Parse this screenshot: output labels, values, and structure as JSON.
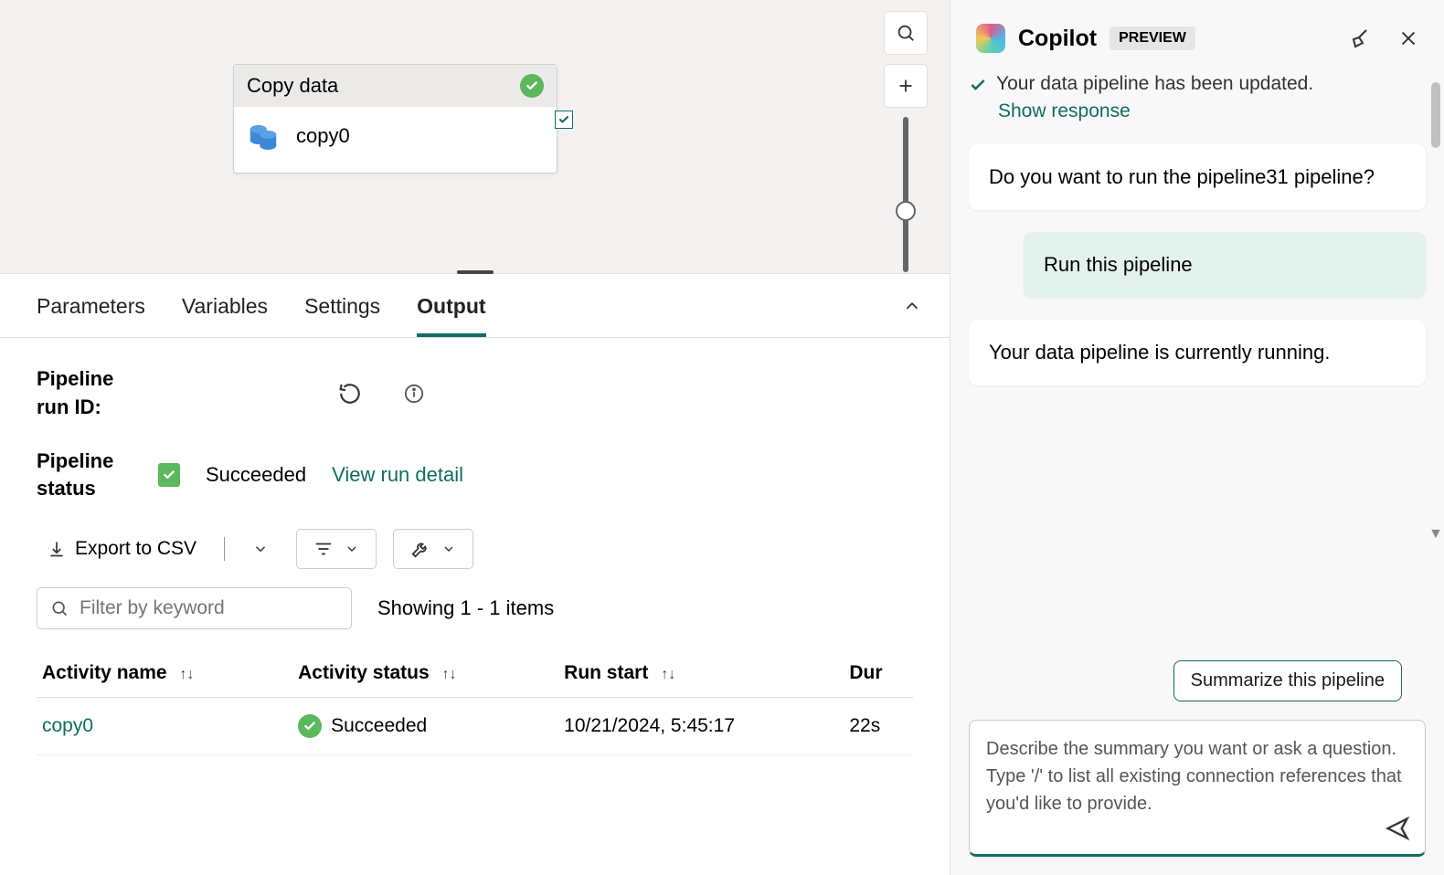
{
  "canvas": {
    "activity": {
      "title": "Copy data",
      "name": "copy0"
    }
  },
  "tabs": {
    "parameters": "Parameters",
    "variables": "Variables",
    "settings": "Settings",
    "output": "Output"
  },
  "output": {
    "run_id_label": "Pipeline run ID:",
    "status_label": "Pipeline status",
    "status_value": "Succeeded",
    "view_detail": "View run detail",
    "export_csv": "Export to CSV",
    "filter_placeholder": "Filter by keyword",
    "showing": "Showing 1 - 1 items",
    "columns": {
      "activity_name": "Activity name",
      "activity_status": "Activity status",
      "run_start": "Run start",
      "duration": "Dur"
    },
    "rows": [
      {
        "name": "copy0",
        "status": "Succeeded",
        "start": "10/21/2024, 5:45:17",
        "duration": "22s"
      }
    ]
  },
  "copilot": {
    "title": "Copilot",
    "badge": "PREVIEW",
    "truncated": "Your data pipeline has been updated.",
    "show_response": "Show response",
    "msg_question": "Do you want to run the pipeline31 pipeline?",
    "msg_user": "Run this pipeline",
    "msg_running": "Your data pipeline is currently running.",
    "suggestion": "Summarize this pipeline",
    "placeholder": "Describe the summary you want or ask a question.\nType '/' to list all existing connection references that you'd like to provide."
  }
}
